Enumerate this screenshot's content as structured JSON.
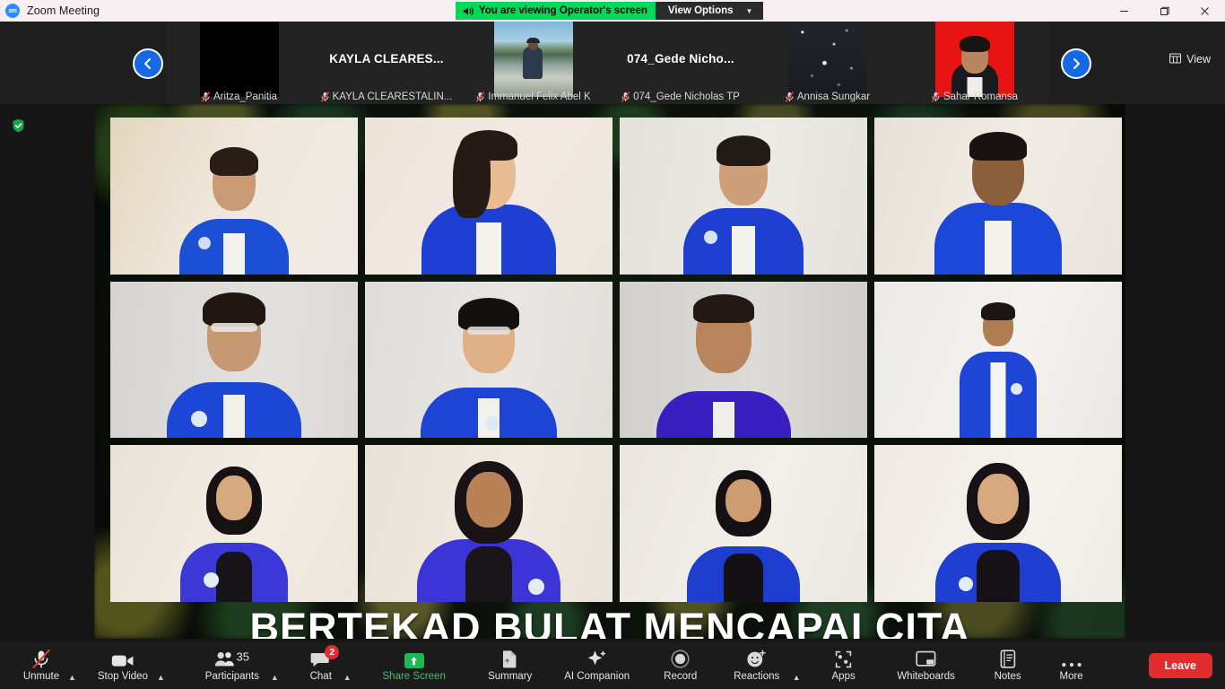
{
  "window": {
    "title": "Zoom Meeting",
    "logo_text": "zm",
    "minimize_icon": "minimize-icon",
    "maximize_icon": "maximize-icon",
    "close_icon": "close-icon"
  },
  "share_banner": {
    "text": "You are viewing Operator's screen",
    "speaker_icon": "speaker-icon",
    "view_options_label": "View Options",
    "view_options_caret": "chevron-down-icon"
  },
  "filmstrip": {
    "prev_arrow_icon": "chevron-left-icon",
    "next_arrow_icon": "chevron-right-icon",
    "view_button_label": "View",
    "view_button_icon": "grid-view-icon",
    "thumbnails": [
      {
        "name": "Aritza_Panitia",
        "display_name": "",
        "muted": true,
        "media": "black"
      },
      {
        "name": "KAYLA CLEARESTALIN...",
        "display_name": "KAYLA  CLEARES...",
        "muted": true,
        "media": "none"
      },
      {
        "name": "Immanuel Felix Abel K",
        "display_name": "",
        "muted": true,
        "media": "beach-photo"
      },
      {
        "name": "074_Gede Nicholas TP",
        "display_name": "074_Gede  Nicho...",
        "muted": true,
        "media": "none"
      },
      {
        "name": "Annisa Sungkar",
        "display_name": "",
        "muted": true,
        "media": "night-sky-photo"
      },
      {
        "name": "Sahar Romansa",
        "display_name": "",
        "muted": true,
        "media": "red-portrait"
      }
    ]
  },
  "stage": {
    "encryption_icon": "shield-check-icon",
    "shared_content": {
      "banner_text": "BERTEKAD BULAT MENCAPAI CITA",
      "grid_rows": 3,
      "grid_cols": 4,
      "participants": [
        {
          "row": 1,
          "col": 1,
          "bg": "#efe7dc",
          "jacket": "#1b4fd6",
          "hair": "#2a1d18",
          "skin": "#c99a73",
          "hair_style": "short",
          "badge": true
        },
        {
          "row": 1,
          "col": 2,
          "bg": "#f0e8e0",
          "jacket": "#1e3fd4",
          "hair": "#241a16",
          "skin": "#e8bb93",
          "hair_style": "long",
          "badge": false
        },
        {
          "row": 1,
          "col": 3,
          "bg": "#e6e3dd",
          "jacket": "#1f3fd0",
          "hair": "#221a15",
          "skin": "#cf9f7a",
          "hair_style": "short",
          "badge": true
        },
        {
          "row": 1,
          "col": 4,
          "bg": "#ece7e0",
          "jacket": "#1c47d8",
          "hair": "#1a1210",
          "skin": "#8b5e3c",
          "hair_style": "short",
          "badge": false
        },
        {
          "row": 2,
          "col": 1,
          "bg": "#dedcd9",
          "jacket": "#1c46d6",
          "hair": "#201713",
          "skin": "#c89872",
          "hair_style": "short",
          "badge": true
        },
        {
          "row": 2,
          "col": 2,
          "bg": "#e4e2de",
          "jacket": "#1d44d4",
          "hair": "#14100e",
          "skin": "#e0b187",
          "hair_style": "short",
          "badge": true
        },
        {
          "row": 2,
          "col": 3,
          "bg": "#dbd9d6",
          "jacket": "#3a1fc0",
          "hair": "#221814",
          "skin": "#b9845c",
          "hair_style": "short",
          "badge": false
        },
        {
          "row": 2,
          "col": 4,
          "bg": "#efefeb",
          "jacket": "#1d45d6",
          "hair": "#1d1512",
          "skin": "#b07c52",
          "hair_style": "short",
          "badge": true
        },
        {
          "row": 3,
          "col": 1,
          "bg": "#efe9e0",
          "jacket": "#3a39d8",
          "hair": "#161214",
          "skin": "#d7a97f",
          "hair_style": "hijab",
          "badge": true
        },
        {
          "row": 3,
          "col": 2,
          "bg": "#ece7df",
          "jacket": "#3b34d6",
          "hair": "#191316",
          "skin": "#b98256",
          "hair_style": "hijab",
          "badge": true
        },
        {
          "row": 3,
          "col": 3,
          "bg": "#eeeae4",
          "jacket": "#1e3ecf",
          "hair": "#141014",
          "skin": "#cf9c72",
          "hair_style": "hijab",
          "badge": false
        },
        {
          "row": 3,
          "col": 4,
          "bg": "#f2eee8",
          "jacket": "#1f3ed2",
          "hair": "#151115",
          "skin": "#d8a87e",
          "hair_style": "hijab",
          "badge": true
        }
      ]
    }
  },
  "controls": {
    "items": [
      {
        "key": "audio",
        "label": "Unmute",
        "icon": "microphone-muted-icon",
        "caret": true,
        "badge": null,
        "count": null,
        "accent": false
      },
      {
        "key": "video",
        "label": "Stop Video",
        "icon": "camera-icon",
        "caret": true,
        "badge": null,
        "count": null,
        "accent": false
      },
      {
        "key": "participants",
        "label": "Participants",
        "icon": "participants-icon",
        "caret": true,
        "badge": null,
        "count": "35",
        "accent": false
      },
      {
        "key": "chat",
        "label": "Chat",
        "icon": "chat-bubble-icon",
        "caret": true,
        "badge": "2",
        "count": null,
        "accent": false
      },
      {
        "key": "share",
        "label": "Share Screen",
        "icon": "share-screen-icon",
        "caret": false,
        "badge": null,
        "count": null,
        "accent": true
      },
      {
        "key": "summary",
        "label": "Summary",
        "icon": "summary-icon",
        "caret": false,
        "badge": null,
        "count": null,
        "accent": false
      },
      {
        "key": "ai",
        "label": "AI Companion",
        "icon": "sparkle-icon",
        "caret": false,
        "badge": null,
        "count": null,
        "accent": false
      },
      {
        "key": "record",
        "label": "Record",
        "icon": "record-icon",
        "caret": false,
        "badge": null,
        "count": null,
        "accent": false
      },
      {
        "key": "reactions",
        "label": "Reactions",
        "icon": "smiley-plus-icon",
        "caret": true,
        "badge": null,
        "count": null,
        "accent": false
      },
      {
        "key": "apps",
        "label": "Apps",
        "icon": "apps-icon",
        "caret": false,
        "badge": null,
        "count": null,
        "accent": false
      },
      {
        "key": "whiteboards",
        "label": "Whiteboards",
        "icon": "whiteboard-icon",
        "caret": false,
        "badge": null,
        "count": null,
        "accent": false
      },
      {
        "key": "notes",
        "label": "Notes",
        "icon": "notes-icon",
        "caret": false,
        "badge": null,
        "count": null,
        "accent": false
      },
      {
        "key": "more",
        "label": "More",
        "icon": "ellipsis-icon",
        "caret": false,
        "badge": null,
        "count": null,
        "accent": false
      }
    ],
    "leave_label": "Leave"
  },
  "colors": {
    "zoom_blue": "#2d8cff",
    "share_green": "#00d95a",
    "accent_green": "#43c16b",
    "leave_red": "#e02d2d",
    "badge_red": "#e02d2d",
    "titlebar_bg": "#f7eff1",
    "chrome_bg": "#1b1b1b"
  }
}
